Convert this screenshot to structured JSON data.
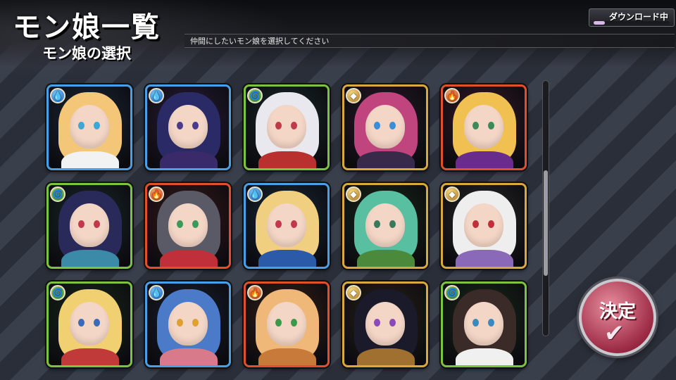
{
  "header": {
    "title": "モン娘一覧",
    "subtitle": "モン娘の選択",
    "instruction": "仲間にしたいモン娘を選択してください"
  },
  "download": {
    "label": "ダウンロード中",
    "progress_percent": 15
  },
  "confirm_button": {
    "label": "決定",
    "icon": "checkmark-icon"
  },
  "scrollbar": {
    "thumb_position_fraction": 0.6
  },
  "element_colors": {
    "water": "#4aa0e6",
    "wind": "#7cc33f",
    "earth": "#d9a93b",
    "fire": "#e0502a"
  },
  "monster_girls": [
    {
      "element": "water",
      "icon": "water-drop-icon",
      "hair": "#f3c777",
      "eyes": "#3fa6d8",
      "outfit": "#f2f2f2",
      "bg": "#1c2a3a"
    },
    {
      "element": "water",
      "icon": "water-drop-icon",
      "hair": "#2a2a66",
      "eyes": "#4b3b8c",
      "outfit": "#3b2a6a",
      "bg": "#2a1d3a"
    },
    {
      "element": "wind",
      "icon": "swirl-icon",
      "hair": "#e8e8ee",
      "eyes": "#c23a4a",
      "outfit": "#b8312f",
      "bg": "#1a2a2a"
    },
    {
      "element": "earth",
      "icon": "gem-icon",
      "hair": "#c0457e",
      "eyes": "#3b8fd8",
      "outfit": "#3a2a4a",
      "bg": "#2a1a2a"
    },
    {
      "element": "fire",
      "icon": "flame-icon",
      "hair": "#f0c050",
      "eyes": "#3a8a5a",
      "outfit": "#6a2c8c",
      "bg": "#3a1a2a"
    },
    {
      "element": "wind",
      "icon": "swirl-icon",
      "hair": "#2a2a5a",
      "eyes": "#c23a4a",
      "outfit": "#3a8aa8",
      "bg": "#1a2a2a"
    },
    {
      "element": "fire",
      "icon": "flame-icon",
      "hair": "#5a5a66",
      "eyes": "#3a9a5a",
      "outfit": "#c0303a",
      "bg": "#3a1a1a"
    },
    {
      "element": "water",
      "icon": "water-drop-icon",
      "hair": "#f0d080",
      "eyes": "#c23a4a",
      "outfit": "#2a5aa8",
      "bg": "#1a2a3a"
    },
    {
      "element": "earth",
      "icon": "gem-icon",
      "hair": "#58c0a0",
      "eyes": "#3a7a5a",
      "outfit": "#4a8a3a",
      "bg": "#1a2a1a"
    },
    {
      "element": "earth",
      "icon": "gem-icon",
      "hair": "#eeeeee",
      "eyes": "#c0303a",
      "outfit": "#8a6ab8",
      "bg": "#2a2a2a"
    },
    {
      "element": "wind",
      "icon": "swirl-icon",
      "hair": "#f0d070",
      "eyes": "#3a6ab8",
      "outfit": "#c03a3a",
      "bg": "#1a2a1a"
    },
    {
      "element": "water",
      "icon": "water-drop-icon",
      "hair": "#4a7ac8",
      "eyes": "#e0a030",
      "outfit": "#d87a8a",
      "bg": "#1a2030"
    },
    {
      "element": "fire",
      "icon": "flame-icon",
      "hair": "#f0b878",
      "eyes": "#3a9a4a",
      "outfit": "#c87a3a",
      "bg": "#3a2218"
    },
    {
      "element": "earth",
      "icon": "gem-icon",
      "hair": "#1a1a2a",
      "eyes": "#8a4ab8",
      "outfit": "#a07030",
      "bg": "#2a2218"
    },
    {
      "element": "wind",
      "icon": "swirl-icon",
      "hair": "#3a2a28",
      "eyes": "#3a8ac0",
      "outfit": "#f0f0f0",
      "bg": "#1a2a1a"
    }
  ]
}
